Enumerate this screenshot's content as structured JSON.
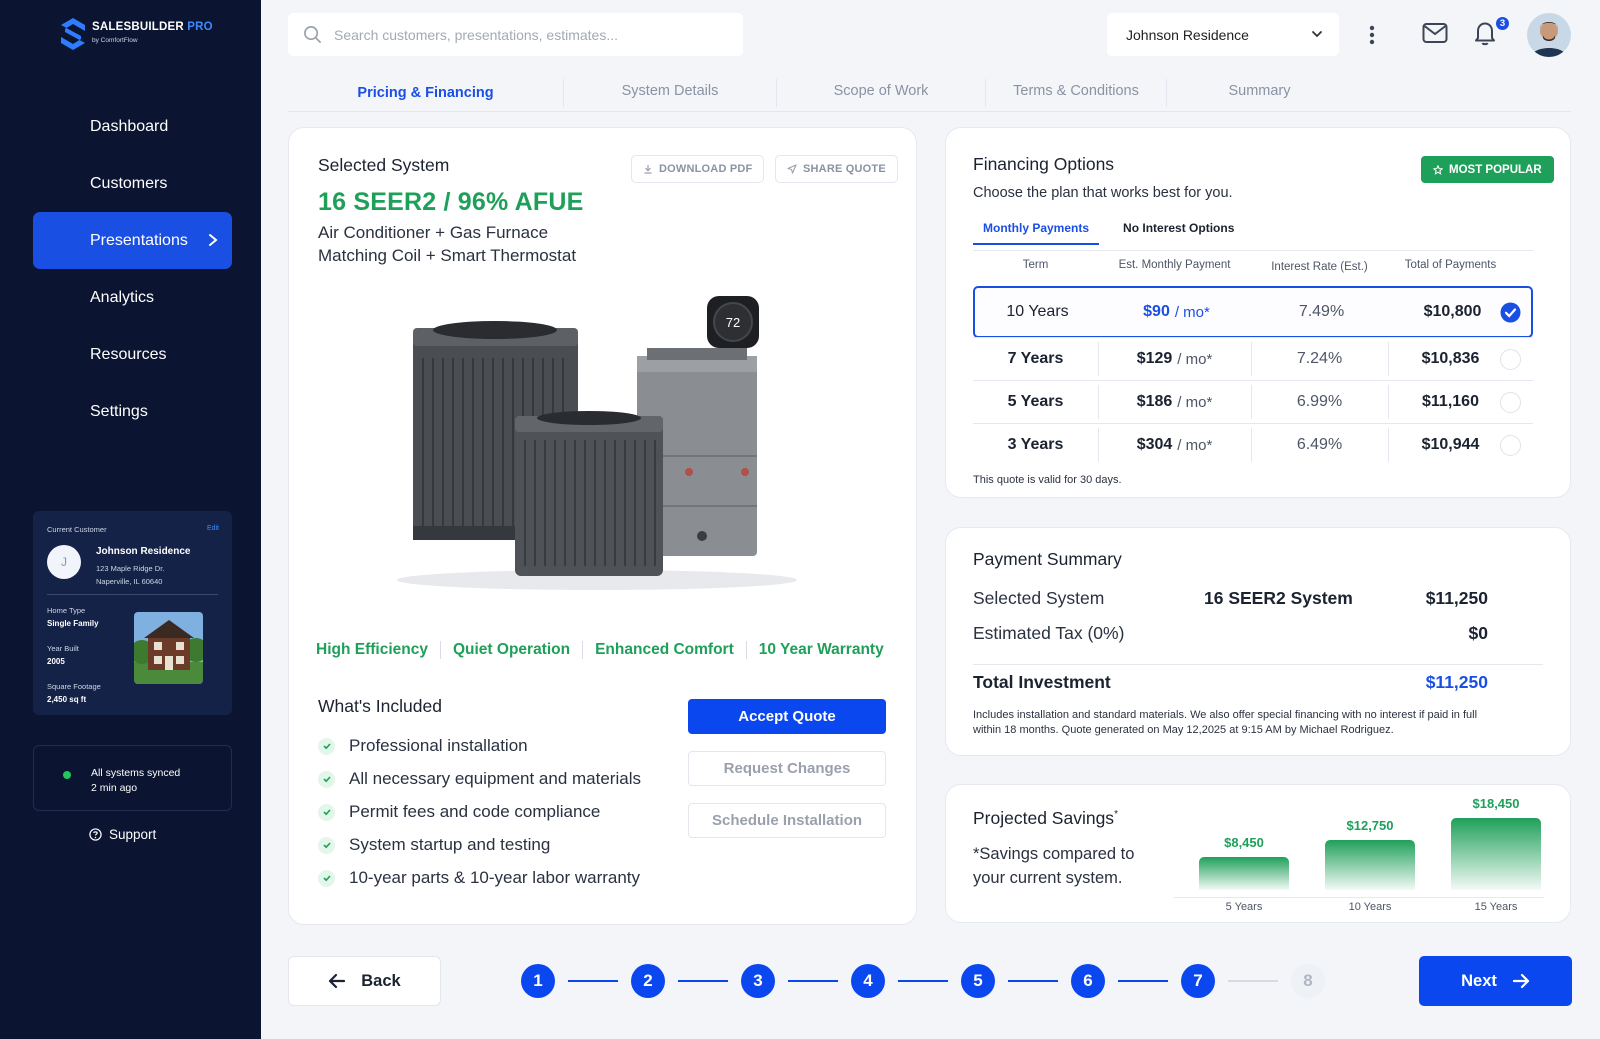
{
  "brand": {
    "name": "SALESBUILDER",
    "suffix": "PRO",
    "sub": "by ComfortFlow"
  },
  "nav": {
    "items": [
      "Dashboard",
      "Customers",
      "Presentations",
      "Analytics",
      "Resources",
      "Settings"
    ],
    "active": "Presentations"
  },
  "customer_card": {
    "label": "Current Customer",
    "edit": "Edit",
    "initial": "J",
    "name": "Johnson Residence",
    "address_1": "123 Maple Ridge Dr.",
    "address_2": "Naperville, IL 60640",
    "home_type_label": "Home Type",
    "home_type": "Single Family",
    "year_label": "Year Built",
    "year": "2005",
    "sqft_label": "Square Footage",
    "sqft": "2,450 sq ft"
  },
  "sync": {
    "line1": "All systems synced",
    "line2": "2 min ago"
  },
  "support": "Support",
  "search": {
    "placeholder": "Search customers, presentations, estimates..."
  },
  "customer_select": "Johnson Residence",
  "notifications": {
    "count": "3"
  },
  "tabs": [
    "Pricing & Financing",
    "System Details",
    "Scope of Work",
    "Terms & Conditions",
    "Summary"
  ],
  "system": {
    "heading": "Selected System",
    "model": "16 SEER2 / 96% AFUE",
    "line1": "Air Conditioner + Gas Furnace",
    "line2": "Matching Coil + Smart Thermostat",
    "download": "DOWNLOAD PDF",
    "share": "SHARE QUOTE",
    "thermostat": "72",
    "features": [
      "High Efficiency",
      "Quiet Operation",
      "Enhanced Comfort",
      "10 Year Warranty"
    ],
    "included_heading": "What's Included",
    "included": [
      "Professional installation",
      "All necessary equipment and materials",
      "Permit fees and code compliance",
      "System startup and testing",
      "10-year parts & 10-year labor warranty"
    ],
    "accept": "Accept Quote",
    "changes": "Request Changes",
    "schedule": "Schedule Installation"
  },
  "financing": {
    "heading": "Financing Options",
    "subheading": "Choose the plan that works best for you.",
    "badge": "MOST POPULAR",
    "tabs": [
      "Monthly Payments",
      "No Interest Options"
    ],
    "columns": [
      "Term",
      "Est. Monthly Payment",
      "Interest Rate (Est.)",
      "Total of Payments"
    ],
    "rows": [
      {
        "term": "10 Years",
        "monthly": "$90",
        "unit": "/ mo*",
        "rate": "7.49%",
        "total": "$10,800",
        "selected": true
      },
      {
        "term": "7 Years",
        "monthly": "$129",
        "unit": "/ mo*",
        "rate": "7.24%",
        "total": "$10,836",
        "selected": false
      },
      {
        "term": "5 Years",
        "monthly": "$186",
        "unit": "/ mo*",
        "rate": "6.99%",
        "total": "$11,160",
        "selected": false
      },
      {
        "term": "3 Years",
        "monthly": "$304",
        "unit": "/ mo*",
        "rate": "6.49%",
        "total": "$10,944",
        "selected": false
      }
    ],
    "validity": "This quote is valid for 30 days."
  },
  "payment": {
    "heading": "Payment Summary",
    "system_label": "Selected System",
    "system_name": "16 SEER2 System",
    "system_price": "$11,250",
    "tax_label": "Estimated Tax (0%)",
    "tax": "$0",
    "total_label": "Total Investment",
    "total": "$11,250",
    "note": "Includes installation and standard materials. We also offer special financing with no interest if paid in full within 18 months. Quote generated on May 12,2025 at 9:15 AM by Michael Rodriguez."
  },
  "savings": {
    "heading": "Projected Savings",
    "mark": "*",
    "note_line1": "*Savings compared to",
    "note_line2": "your current system.",
    "bars": [
      {
        "label": "5 Years",
        "value": 8450,
        "text": "$8,450"
      },
      {
        "label": "10 Years",
        "value": 12750,
        "text": "$12,750"
      },
      {
        "label": "15 Years",
        "value": 18450,
        "text": "$18,450"
      }
    ]
  },
  "footer": {
    "back": "Back",
    "next": "Next",
    "steps": [
      "1",
      "2",
      "3",
      "4",
      "5",
      "6",
      "7",
      "8"
    ],
    "current_step": 7
  },
  "colors": {
    "primary": "#0a47ef",
    "accent_green": "#1fa05a",
    "sidebar": "#0b1430"
  }
}
